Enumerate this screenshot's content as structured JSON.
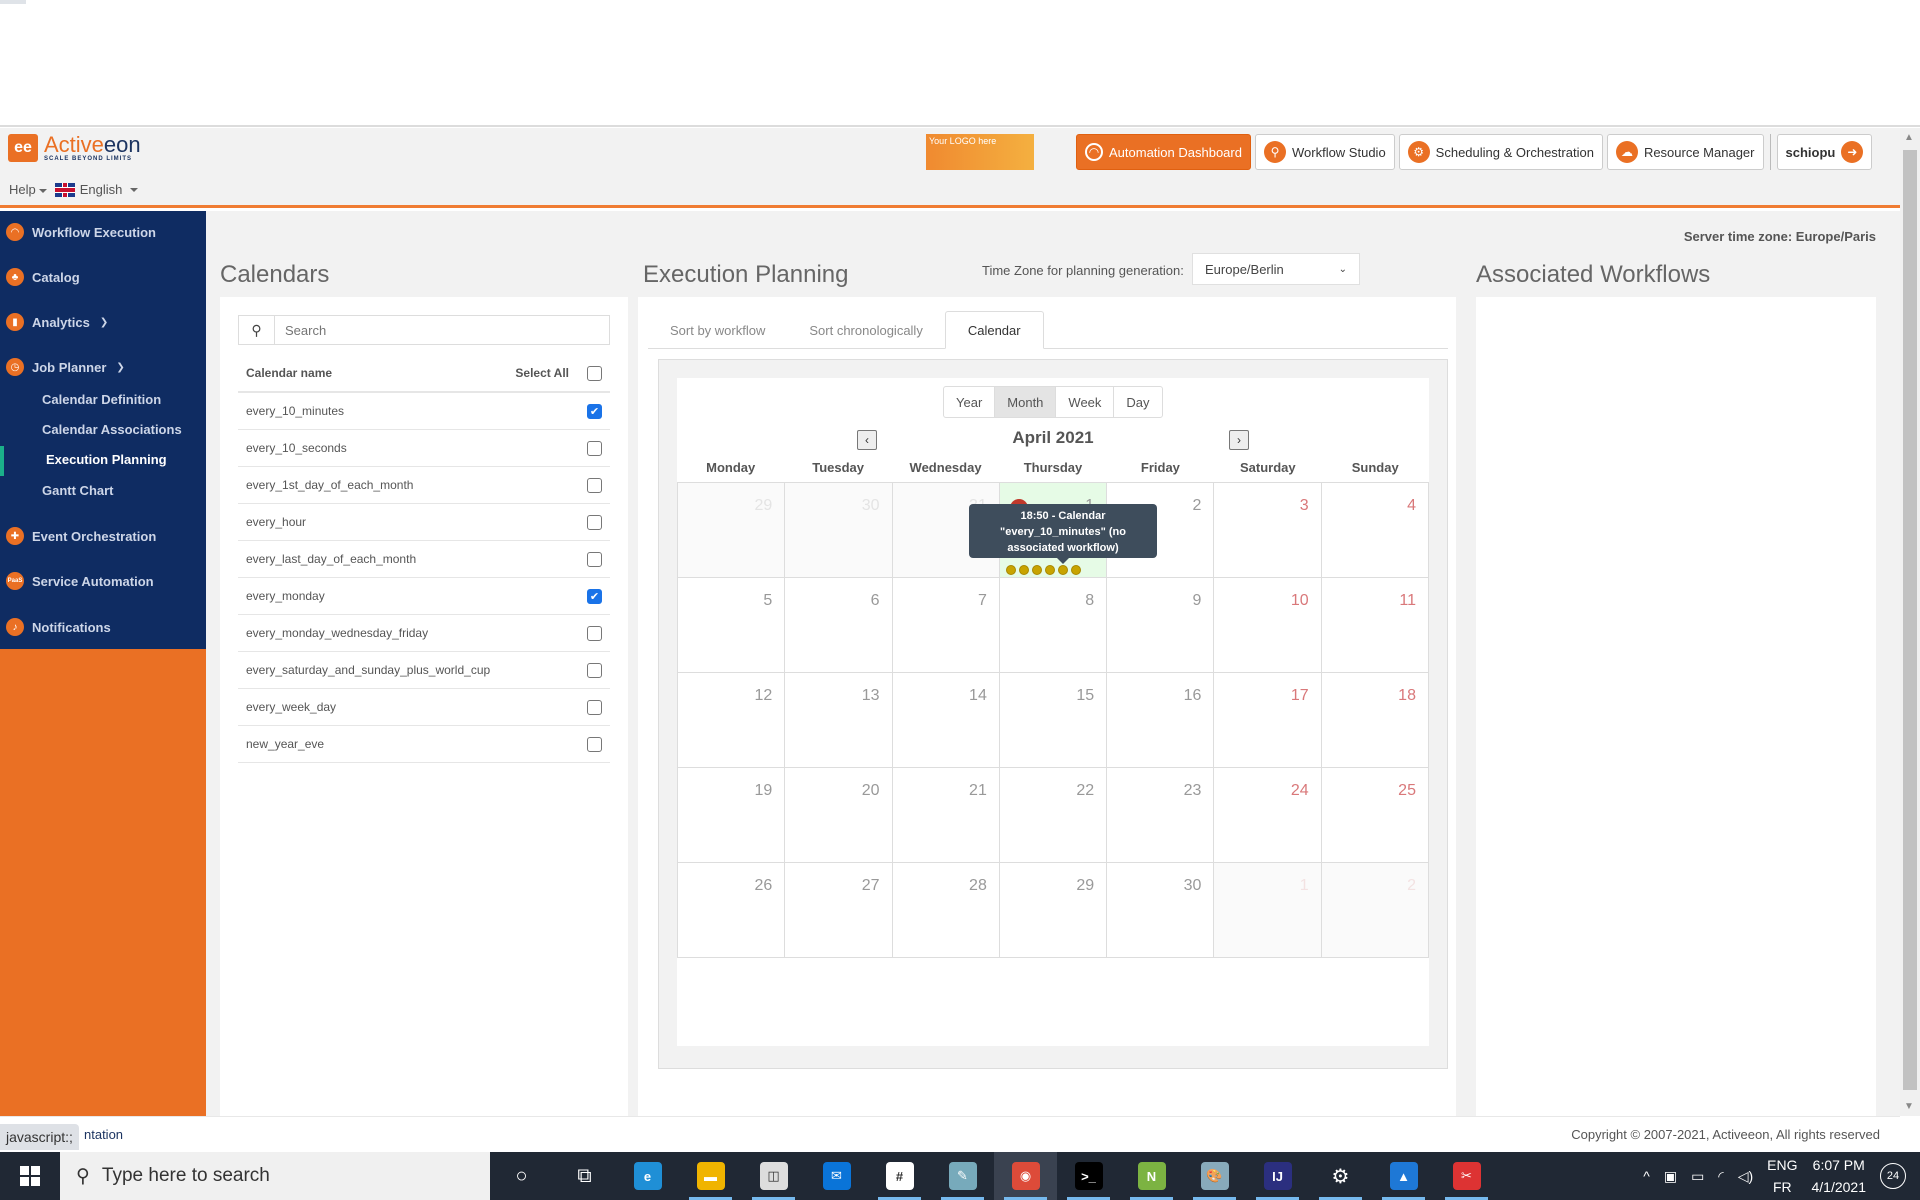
{
  "header": {
    "brand": "Activeeon",
    "brand_part1": "Active",
    "brand_part2": "eon",
    "tagline": "SCALE BEYOND LIMITS",
    "help_label": "Help",
    "language_label": "English",
    "custom_logo_text": "Your LOGO here",
    "nav": [
      {
        "label": "Automation Dashboard",
        "icon": "gauge-icon",
        "active": true
      },
      {
        "label": "Workflow Studio",
        "icon": "workflow-icon",
        "active": false
      },
      {
        "label": "Scheduling & Orchestration",
        "icon": "gears-icon",
        "active": false
      },
      {
        "label": "Resource Manager",
        "icon": "cloud-icon",
        "active": false
      }
    ],
    "user": "schiopu",
    "accent_color": "#ea7024"
  },
  "sidebar": {
    "items": [
      {
        "label": "Workflow Execution",
        "icon": "gauge-icon"
      },
      {
        "label": "Catalog",
        "icon": "catalog-icon"
      },
      {
        "label": "Analytics",
        "icon": "analytics-icon",
        "expandable": true
      },
      {
        "label": "Job Planner",
        "icon": "clock-icon",
        "expandable": true,
        "expanded": true
      },
      {
        "label": "Event Orchestration",
        "icon": "pulse-icon"
      },
      {
        "label": "Service Automation",
        "icon": "paas-icon"
      },
      {
        "label": "Notifications",
        "icon": "bell-icon"
      }
    ],
    "job_planner_sub": [
      {
        "label": "Calendar Definition",
        "active": false
      },
      {
        "label": "Calendar Associations",
        "active": false
      },
      {
        "label": "Execution Planning",
        "active": true
      },
      {
        "label": "Gantt Chart",
        "active": false
      }
    ],
    "bg_color": "#0f2c62"
  },
  "main": {
    "server_timezone": "Server time zone: Europe/Paris",
    "calendars": {
      "title": "Calendars",
      "search_placeholder": "Search",
      "col_name": "Calendar name",
      "select_all": "Select All",
      "select_all_checked": false,
      "rows": [
        {
          "name": "every_10_minutes",
          "checked": true
        },
        {
          "name": "every_10_seconds",
          "checked": false
        },
        {
          "name": "every_1st_day_of_each_month",
          "checked": false
        },
        {
          "name": "every_hour",
          "checked": false
        },
        {
          "name": "every_last_day_of_each_month",
          "checked": false
        },
        {
          "name": "every_monday",
          "checked": true
        },
        {
          "name": "every_monday_wednesday_friday",
          "checked": false
        },
        {
          "name": "every_saturday_and_sunday_plus_world_cup",
          "checked": false
        },
        {
          "name": "every_week_day",
          "checked": false
        },
        {
          "name": "new_year_eve",
          "checked": false
        }
      ]
    },
    "planning": {
      "title": "Execution Planning",
      "tz_label": "Time Zone for planning generation:",
      "tz_value": "Europe/Berlin",
      "tabs": [
        {
          "label": "Sort by workflow",
          "active": false
        },
        {
          "label": "Sort chronologically",
          "active": false
        },
        {
          "label": "Calendar",
          "active": true
        }
      ],
      "views": [
        {
          "label": "Year",
          "active": false
        },
        {
          "label": "Month",
          "active": true
        },
        {
          "label": "Week",
          "active": false
        },
        {
          "label": "Day",
          "active": false
        }
      ],
      "month_title": "April 2021",
      "weekdays": [
        "Monday",
        "Tuesday",
        "Wednesday",
        "Thursday",
        "Friday",
        "Saturday",
        "Sunday"
      ],
      "weeks": [
        [
          {
            "d": "29",
            "other": true
          },
          {
            "d": "30",
            "other": true
          },
          {
            "d": "31",
            "other": true
          },
          {
            "d": "1",
            "today": true,
            "events": 6,
            "badge": "6"
          },
          {
            "d": "2"
          },
          {
            "d": "3",
            "weekend": true
          },
          {
            "d": "4",
            "weekend": true
          }
        ],
        [
          {
            "d": "5"
          },
          {
            "d": "6"
          },
          {
            "d": "7"
          },
          {
            "d": "8"
          },
          {
            "d": "9"
          },
          {
            "d": "10",
            "weekend": true
          },
          {
            "d": "11",
            "weekend": true
          }
        ],
        [
          {
            "d": "12"
          },
          {
            "d": "13"
          },
          {
            "d": "14"
          },
          {
            "d": "15"
          },
          {
            "d": "16"
          },
          {
            "d": "17",
            "weekend": true
          },
          {
            "d": "18",
            "weekend": true
          }
        ],
        [
          {
            "d": "19"
          },
          {
            "d": "20"
          },
          {
            "d": "21"
          },
          {
            "d": "22"
          },
          {
            "d": "23"
          },
          {
            "d": "24",
            "weekend": true
          },
          {
            "d": "25",
            "weekend": true
          }
        ],
        [
          {
            "d": "26"
          },
          {
            "d": "27"
          },
          {
            "d": "28"
          },
          {
            "d": "29"
          },
          {
            "d": "30"
          },
          {
            "d": "1",
            "other": true,
            "weekend": true
          },
          {
            "d": "2",
            "other": true,
            "weekend": true
          }
        ]
      ],
      "tooltip": "18:50 - Calendar \"every_10_minutes\" (no associated workflow)",
      "event_color": "#c8a400"
    },
    "associated": {
      "title": "Associated Workflows"
    }
  },
  "footer": {
    "doc_link": "ntation",
    "status_url": "javascript:;",
    "copyright": "Copyright © 2007-2021, Activeeon, All rights reserved"
  },
  "taskbar": {
    "search_placeholder": "Type here to search",
    "apps": [
      "cortana-icon",
      "task-view-icon",
      "edge-icon",
      "file-explorer-icon",
      "store-icon",
      "mail-icon",
      "slack-icon",
      "notepad-icon",
      "chrome-icon",
      "terminal-icon",
      "notepadpp-icon",
      "paint-icon",
      "intellij-icon",
      "settings-icon",
      "photos-icon",
      "snipping-tool-icon"
    ],
    "lang_top": "ENG",
    "lang_bottom": "FR",
    "time": "6:07 PM",
    "date": "4/1/2021",
    "notifications": "24"
  }
}
